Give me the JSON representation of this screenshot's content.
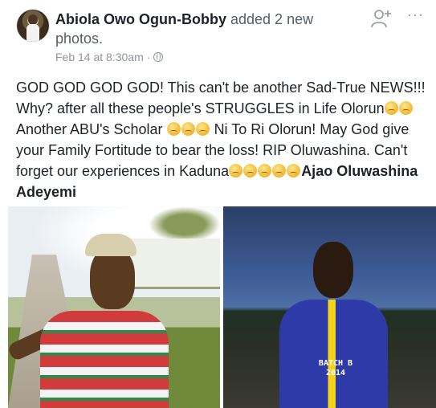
{
  "post": {
    "author": "Abiola Owo Ogun-Bobby",
    "action": "added 2 new photos.",
    "timestamp": "Feb 14 at 8:30am",
    "separator": "·",
    "privacy_icon": "globe-icon",
    "more_label": "···"
  },
  "text": {
    "line1": "GOD GOD GOD GOD! This can't be another Sad-True NEWS!!! Why? after all these people's STRUGGLES in Life Olorun",
    "line2": "Another ABU's Scholar",
    "line3": "Ni To Ri Olorun! May God give your Family Fortitude to bear the loss! RIP Oluwashina. Can't forget our experiences in Kaduna",
    "tag": "Ajao Oluwashina Adeyemi"
  },
  "photos": {
    "photo2_jersey_line1": "BATCH B",
    "photo2_jersey_line2": "2014"
  }
}
